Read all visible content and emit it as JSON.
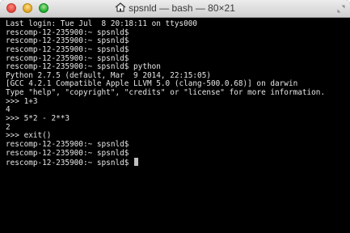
{
  "window": {
    "title": "spsnld — bash — 80×21"
  },
  "icons": {
    "title": "home-folder-icon",
    "resize": "fullscreen-arrows-icon"
  },
  "colors": {
    "terminal_bg": "#000000",
    "terminal_fg": "#e6e6e6",
    "titlebar_bg": "#dcdcdc"
  },
  "terminal": {
    "lines": [
      "Last login: Tue Jul  8 20:18:11 on ttys000",
      "rescomp-12-235900:~ spsnld$",
      "rescomp-12-235900:~ spsnld$",
      "rescomp-12-235900:~ spsnld$",
      "rescomp-12-235900:~ spsnld$",
      "rescomp-12-235900:~ spsnld$ python",
      "Python 2.7.5 (default, Mar  9 2014, 22:15:05)",
      "[GCC 4.2.1 Compatible Apple LLVM 5.0 (clang-500.0.68)] on darwin",
      "Type \"help\", \"copyright\", \"credits\" or \"license\" for more information.",
      ">>> 1+3",
      "4",
      ">>> 5*2 - 2**3",
      "2",
      ">>> exit()",
      "rescomp-12-235900:~ spsnld$",
      "rescomp-12-235900:~ spsnld$",
      "rescomp-12-235900:~ spsnld$ "
    ]
  }
}
